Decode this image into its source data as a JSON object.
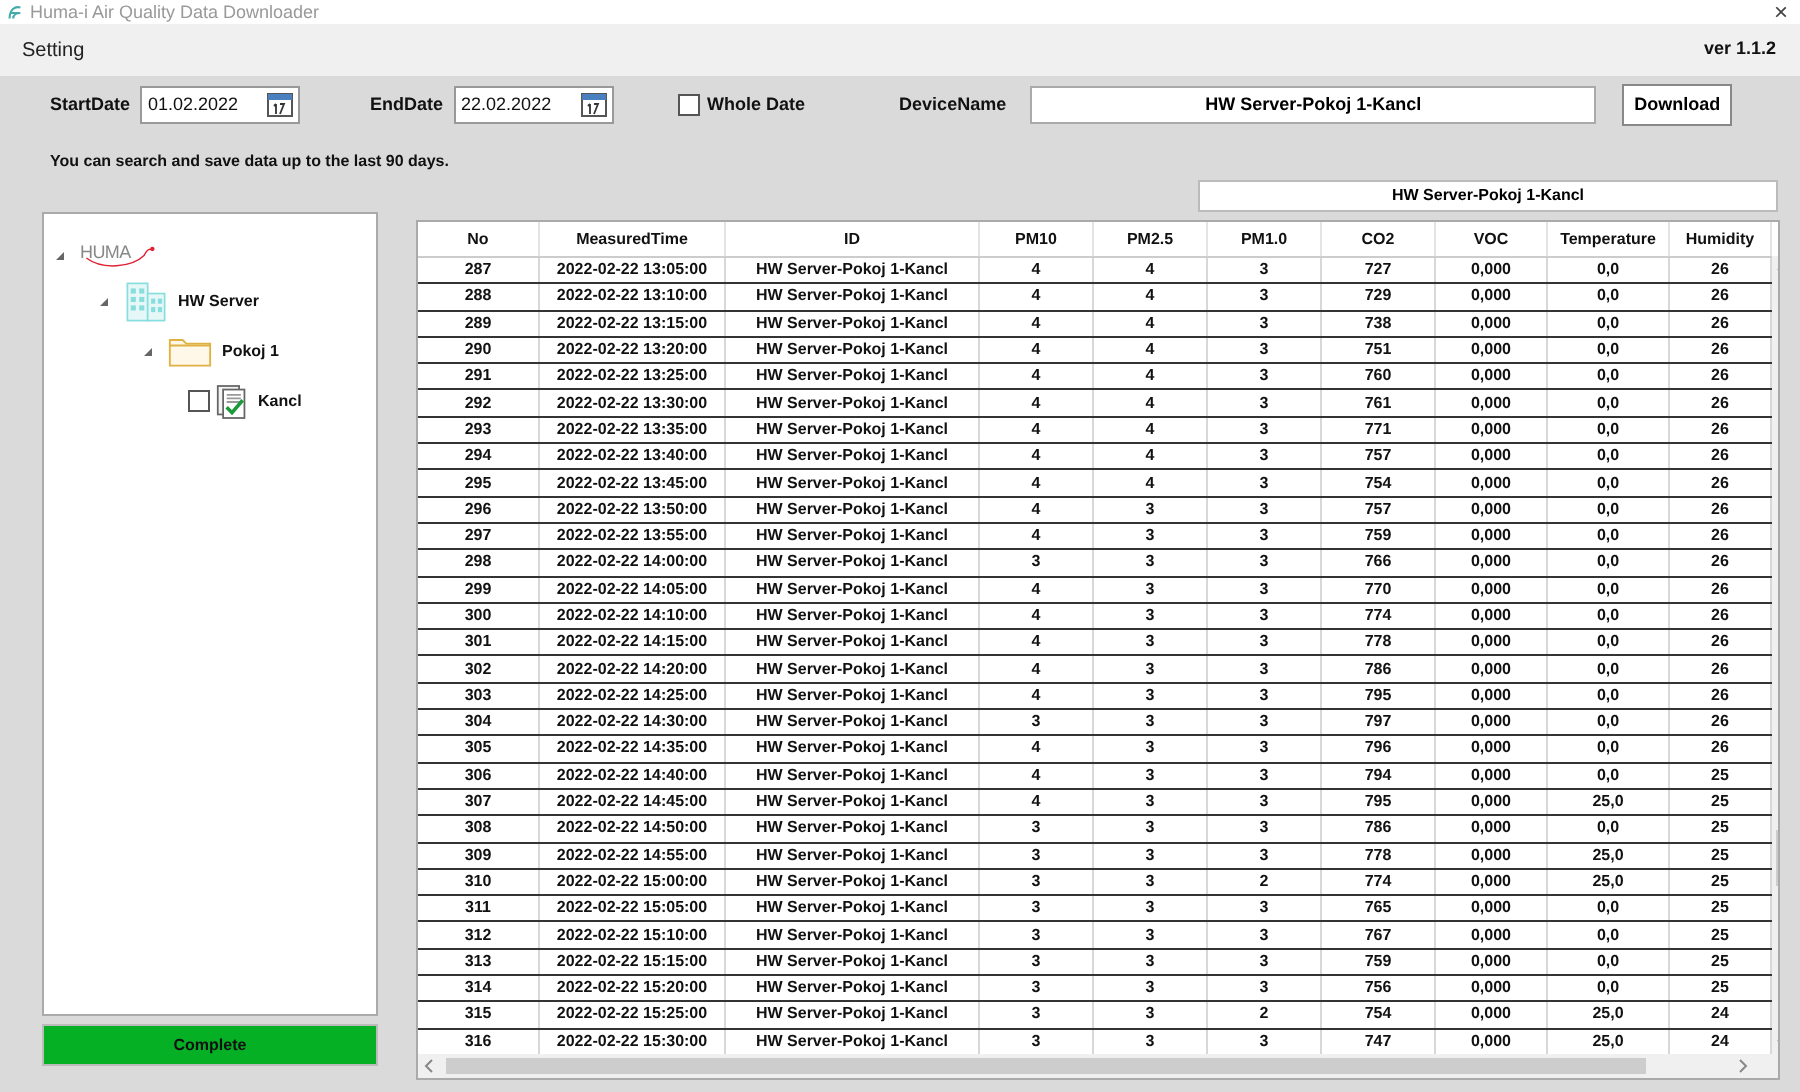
{
  "window": {
    "title": "Huma-i Air Quality Data Downloader",
    "close": "×"
  },
  "menu": {
    "items": [
      "Setting"
    ],
    "version": "ver 1.1.2"
  },
  "filters": {
    "start_label": "StartDate",
    "start_value": "01.02.2022",
    "end_label": "EndDate",
    "end_value": "22.02.2022",
    "whole_date": {
      "label": "Whole Date",
      "checked": false
    },
    "device_label": "DeviceName",
    "device_value": "HW Server-Pokoj 1-Kancl",
    "download": "Download"
  },
  "info": "You can search and save data up to the last 90 days.",
  "selected_device": "HW Server-Pokoj 1-Kancl",
  "tree": {
    "logo": "HUMA",
    "expanded": true,
    "children": [
      {
        "label": "HW Server",
        "kind": "server",
        "expanded": true,
        "children": [
          {
            "label": "Pokoj 1",
            "kind": "folder",
            "expanded": true,
            "children": [
              {
                "label": "Kancl",
                "kind": "device",
                "checked": false
              }
            ]
          }
        ]
      }
    ]
  },
  "progress": {
    "label": "Complete",
    "level": 1
  },
  "table": {
    "columns": [
      "No",
      "MeasuredTime",
      "ID",
      "PM10",
      "PM2.5",
      "PM1.0",
      "CO2",
      "VOC",
      "Temperature",
      "Humidity"
    ],
    "rows": [
      [
        "287",
        "2022-02-22 13:05:00",
        "HW Server-Pokoj 1-Kancl",
        "4",
        "4",
        "3",
        "727",
        "0,000",
        "0,0",
        "26"
      ],
      [
        "288",
        "2022-02-22 13:10:00",
        "HW Server-Pokoj 1-Kancl",
        "4",
        "4",
        "3",
        "729",
        "0,000",
        "0,0",
        "26"
      ],
      [
        "289",
        "2022-02-22 13:15:00",
        "HW Server-Pokoj 1-Kancl",
        "4",
        "4",
        "3",
        "738",
        "0,000",
        "0,0",
        "26"
      ],
      [
        "290",
        "2022-02-22 13:20:00",
        "HW Server-Pokoj 1-Kancl",
        "4",
        "4",
        "3",
        "751",
        "0,000",
        "0,0",
        "26"
      ],
      [
        "291",
        "2022-02-22 13:25:00",
        "HW Server-Pokoj 1-Kancl",
        "4",
        "4",
        "3",
        "760",
        "0,000",
        "0,0",
        "26"
      ],
      [
        "292",
        "2022-02-22 13:30:00",
        "HW Server-Pokoj 1-Kancl",
        "4",
        "4",
        "3",
        "761",
        "0,000",
        "0,0",
        "26"
      ],
      [
        "293",
        "2022-02-22 13:35:00",
        "HW Server-Pokoj 1-Kancl",
        "4",
        "4",
        "3",
        "771",
        "0,000",
        "0,0",
        "26"
      ],
      [
        "294",
        "2022-02-22 13:40:00",
        "HW Server-Pokoj 1-Kancl",
        "4",
        "4",
        "3",
        "757",
        "0,000",
        "0,0",
        "26"
      ],
      [
        "295",
        "2022-02-22 13:45:00",
        "HW Server-Pokoj 1-Kancl",
        "4",
        "4",
        "3",
        "754",
        "0,000",
        "0,0",
        "26"
      ],
      [
        "296",
        "2022-02-22 13:50:00",
        "HW Server-Pokoj 1-Kancl",
        "4",
        "3",
        "3",
        "757",
        "0,000",
        "0,0",
        "26"
      ],
      [
        "297",
        "2022-02-22 13:55:00",
        "HW Server-Pokoj 1-Kancl",
        "4",
        "3",
        "3",
        "759",
        "0,000",
        "0,0",
        "26"
      ],
      [
        "298",
        "2022-02-22 14:00:00",
        "HW Server-Pokoj 1-Kancl",
        "3",
        "3",
        "3",
        "766",
        "0,000",
        "0,0",
        "26"
      ],
      [
        "299",
        "2022-02-22 14:05:00",
        "HW Server-Pokoj 1-Kancl",
        "4",
        "3",
        "3",
        "770",
        "0,000",
        "0,0",
        "26"
      ],
      [
        "300",
        "2022-02-22 14:10:00",
        "HW Server-Pokoj 1-Kancl",
        "4",
        "3",
        "3",
        "774",
        "0,000",
        "0,0",
        "26"
      ],
      [
        "301",
        "2022-02-22 14:15:00",
        "HW Server-Pokoj 1-Kancl",
        "4",
        "3",
        "3",
        "778",
        "0,000",
        "0,0",
        "26"
      ],
      [
        "302",
        "2022-02-22 14:20:00",
        "HW Server-Pokoj 1-Kancl",
        "4",
        "3",
        "3",
        "786",
        "0,000",
        "0,0",
        "26"
      ],
      [
        "303",
        "2022-02-22 14:25:00",
        "HW Server-Pokoj 1-Kancl",
        "4",
        "3",
        "3",
        "795",
        "0,000",
        "0,0",
        "26"
      ],
      [
        "304",
        "2022-02-22 14:30:00",
        "HW Server-Pokoj 1-Kancl",
        "3",
        "3",
        "3",
        "797",
        "0,000",
        "0,0",
        "26"
      ],
      [
        "305",
        "2022-02-22 14:35:00",
        "HW Server-Pokoj 1-Kancl",
        "4",
        "3",
        "3",
        "796",
        "0,000",
        "0,0",
        "26"
      ],
      [
        "306",
        "2022-02-22 14:40:00",
        "HW Server-Pokoj 1-Kancl",
        "4",
        "3",
        "3",
        "794",
        "0,000",
        "0,0",
        "25"
      ],
      [
        "307",
        "2022-02-22 14:45:00",
        "HW Server-Pokoj 1-Kancl",
        "4",
        "3",
        "3",
        "795",
        "0,000",
        "25,0",
        "25"
      ],
      [
        "308",
        "2022-02-22 14:50:00",
        "HW Server-Pokoj 1-Kancl",
        "3",
        "3",
        "3",
        "786",
        "0,000",
        "0,0",
        "25"
      ],
      [
        "309",
        "2022-02-22 14:55:00",
        "HW Server-Pokoj 1-Kancl",
        "3",
        "3",
        "3",
        "778",
        "0,000",
        "25,0",
        "25"
      ],
      [
        "310",
        "2022-02-22 15:00:00",
        "HW Server-Pokoj 1-Kancl",
        "3",
        "3",
        "2",
        "774",
        "0,000",
        "25,0",
        "25"
      ],
      [
        "311",
        "2022-02-22 15:05:00",
        "HW Server-Pokoj 1-Kancl",
        "3",
        "3",
        "3",
        "765",
        "0,000",
        "0,0",
        "25"
      ],
      [
        "312",
        "2022-02-22 15:10:00",
        "HW Server-Pokoj 1-Kancl",
        "3",
        "3",
        "3",
        "767",
        "0,000",
        "0,0",
        "25"
      ],
      [
        "313",
        "2022-02-22 15:15:00",
        "HW Server-Pokoj 1-Kancl",
        "3",
        "3",
        "3",
        "759",
        "0,000",
        "0,0",
        "25"
      ],
      [
        "314",
        "2022-02-22 15:20:00",
        "HW Server-Pokoj 1-Kancl",
        "3",
        "3",
        "3",
        "756",
        "0,000",
        "0,0",
        "25"
      ],
      [
        "315",
        "2022-02-22 15:25:00",
        "HW Server-Pokoj 1-Kancl",
        "3",
        "3",
        "2",
        "754",
        "0,000",
        "25,0",
        "24"
      ],
      [
        "316",
        "2022-02-22 15:30:00",
        "HW Server-Pokoj 1-Kancl",
        "3",
        "3",
        "3",
        "747",
        "0,000",
        "25,0",
        "24"
      ]
    ]
  }
}
